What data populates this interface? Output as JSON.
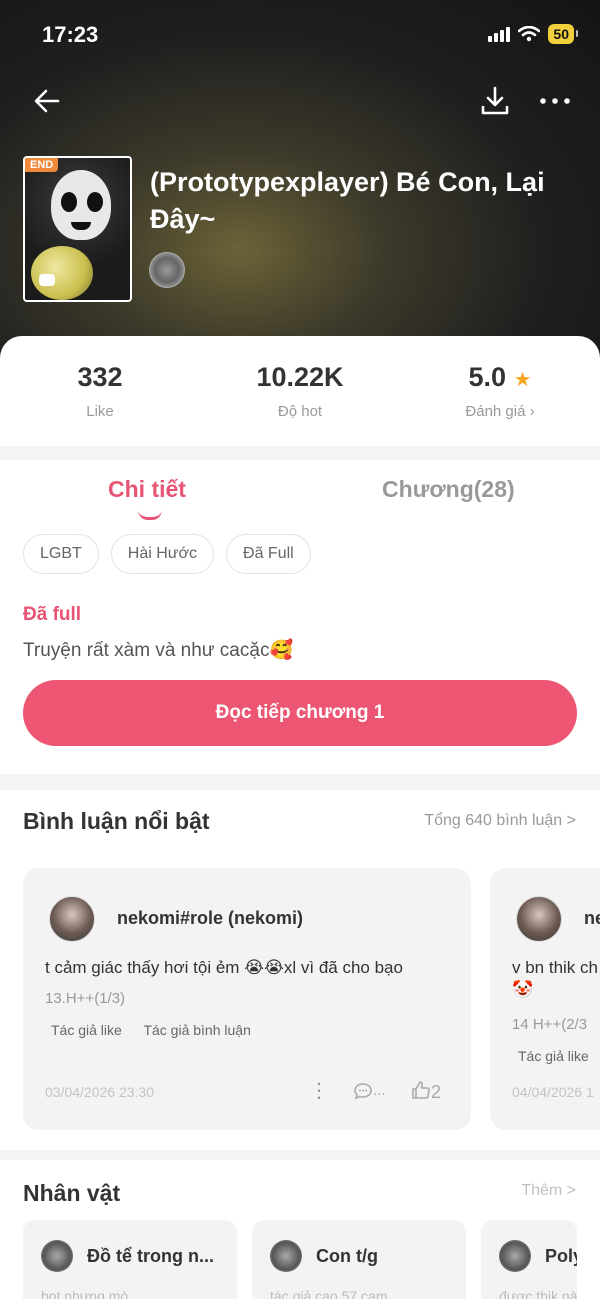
{
  "status_bar": {
    "time": "17:23",
    "battery": "50"
  },
  "book": {
    "cover_badge": "END",
    "title": "(Prototypexplayer) Bé Con, Lại Đây~"
  },
  "stats": [
    {
      "value": "332",
      "label": "Like"
    },
    {
      "value": "10.22K",
      "label": "Độ hot"
    },
    {
      "value": "5.0",
      "label": "Đánh giá ›"
    }
  ],
  "tabs": {
    "details": "Chi tiết",
    "chapters": "Chương(28)"
  },
  "tags": [
    "LGBT",
    "Hài Hước",
    "Đã Full"
  ],
  "detail": {
    "status": "Đã full",
    "description": "Truyện rất xàm và như cacặc🥰",
    "read_button": "Đọc tiếp chương 1"
  },
  "comments": {
    "title": "Bình luận nổi bật",
    "total_link": "Tổng 640 bình luận >",
    "items": [
      {
        "username": "nekomi#role (nekomi)",
        "text": "t cảm giác thấy hơi tội ẻm 😭😭xl vì đã cho bạo",
        "sub": "13.H++(1/3)",
        "badge1": "Tác giả like",
        "badge2": "Tác giả bình luận",
        "date": "03/04/2026 23:30",
        "comment_count": "...",
        "likes": "2"
      },
      {
        "username": "ne",
        "text": "v bn thik ch",
        "emoji": "🤡",
        "sub": "14 H++(2/3",
        "badge1": "Tác giả like",
        "date": "04/04/2026 1"
      }
    ]
  },
  "characters": {
    "title": "Nhân vật",
    "more_link": "Thêm >",
    "items": [
      {
        "name": "Đồ tể trong n...",
        "desc": "bot nhưng mò"
      },
      {
        "name": "Con t/g",
        "desc": "tác giả cao 57 cam"
      },
      {
        "name": "Poly",
        "desc": "được thik nà"
      }
    ]
  }
}
